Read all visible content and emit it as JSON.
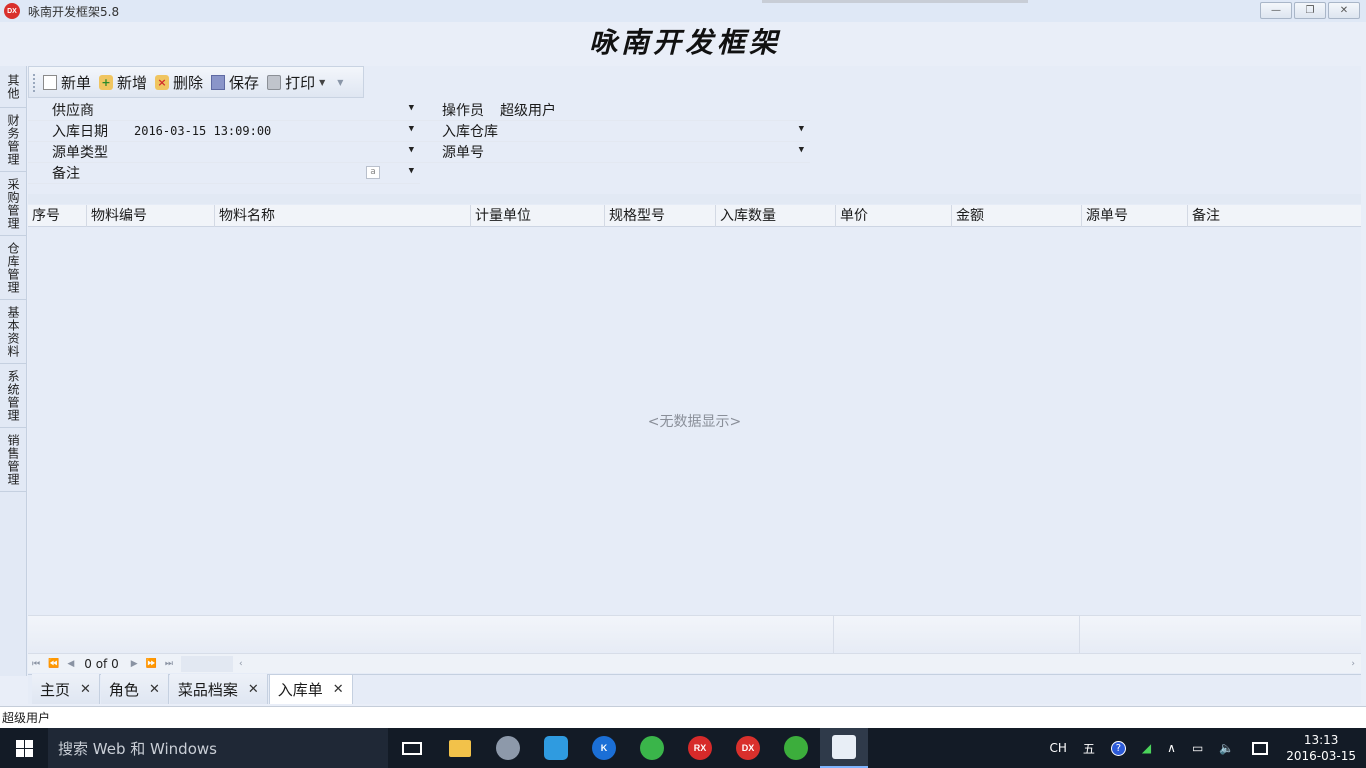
{
  "window": {
    "title": "咏南开发框架5.8",
    "app_icon_text": "DX",
    "banner": "咏南开发框架",
    "buttons": [
      "—",
      "❐",
      "✕"
    ]
  },
  "sidebar": {
    "items": [
      {
        "label": "其他"
      },
      {
        "label": "财务管理"
      },
      {
        "label": "采购管理"
      },
      {
        "label": "仓库管理"
      },
      {
        "label": "基本资料"
      },
      {
        "label": "系统管理"
      },
      {
        "label": "销售管理"
      }
    ]
  },
  "toolbar": {
    "new_doc": "新单",
    "add": "新增",
    "delete": "删除",
    "save": "保存",
    "print": "打印"
  },
  "form": {
    "supplier": {
      "label": "供应商",
      "value": ""
    },
    "operator": {
      "label": "操作员",
      "value": "超级用户"
    },
    "in_date": {
      "label": "入库日期",
      "value": "2016-03-15 13:09:00"
    },
    "warehouse": {
      "label": "入库仓库",
      "value": ""
    },
    "source_type": {
      "label": "源单类型",
      "value": ""
    },
    "source_no": {
      "label": "源单号",
      "value": ""
    },
    "remark": {
      "label": "备注",
      "value": ""
    }
  },
  "grid": {
    "columns": [
      "序号",
      "物料编号",
      "物料名称",
      "计量单位",
      "规格型号",
      "入库数量",
      "单价",
      "金额",
      "源单号",
      "备注"
    ],
    "empty_text": "<无数据显示>",
    "pager_text": "0 of 0"
  },
  "doc_tabs": [
    {
      "label": "主页",
      "active": false
    },
    {
      "label": "角色",
      "active": false
    },
    {
      "label": "菜品档案",
      "active": false
    },
    {
      "label": "入库单",
      "active": true
    }
  ],
  "status": {
    "user": "超级用户"
  },
  "taskbar": {
    "search_placeholder": "搜索 Web 和 Windows",
    "apps": [
      {
        "name": "task-view-icon"
      },
      {
        "name": "file-explorer-icon"
      },
      {
        "name": "snipping-tool-icon"
      },
      {
        "name": "bird-app-icon",
        "text": ""
      },
      {
        "name": "k-app-icon",
        "text": "K"
      },
      {
        "name": "wifi-app-icon",
        "text": ""
      },
      {
        "name": "rx-app-icon",
        "text": "RX"
      },
      {
        "name": "dx-app-icon",
        "text": "DX"
      },
      {
        "name": "sync-app-icon",
        "text": ""
      },
      {
        "name": "framework-app-icon",
        "text": ""
      }
    ],
    "tray": {
      "lang": "CH",
      "ime": "五",
      "help": "?",
      "time": "13:13",
      "date": "2016-03-15"
    }
  }
}
